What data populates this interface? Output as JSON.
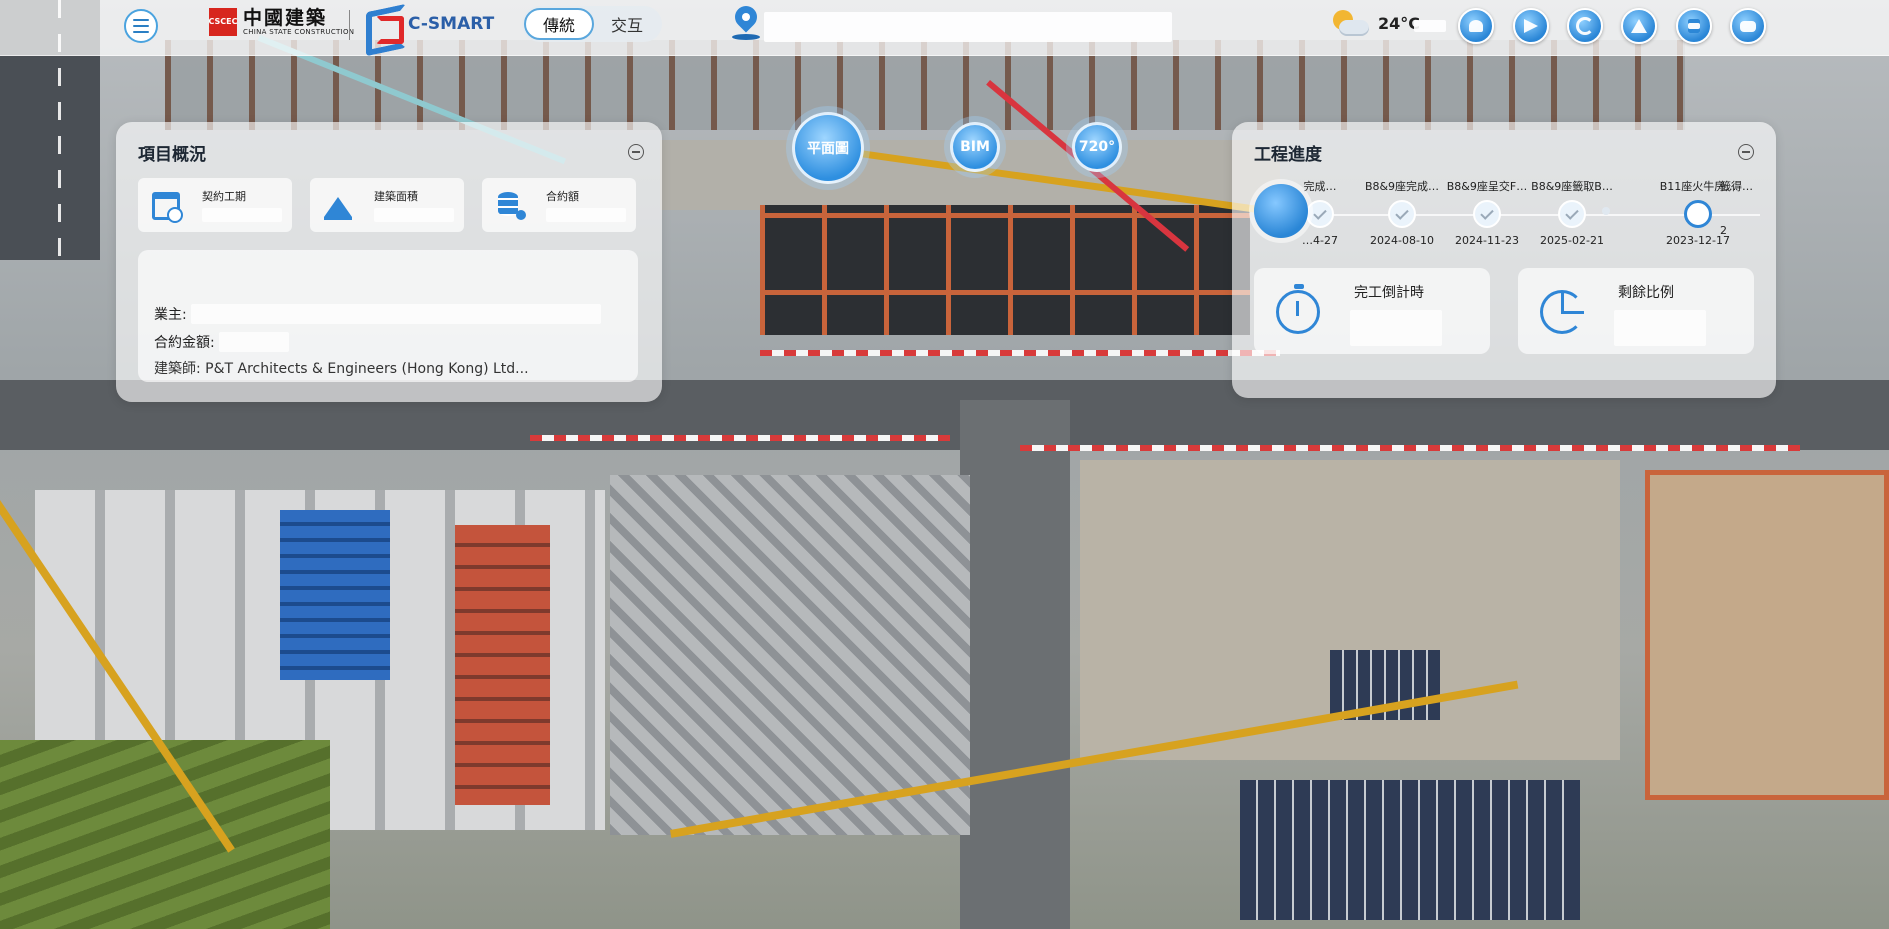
{
  "header": {
    "logo_mark_text": "CSCEC",
    "company_cn": "中國建築",
    "company_en": "CHINA STATE CONSTRUCTION",
    "product_name": "C-SMART",
    "mode_tabs": [
      {
        "label": "傳統",
        "active": true
      },
      {
        "label": "交互",
        "active": false
      }
    ],
    "search_value": "",
    "weather_icon": "partly-cloudy-icon",
    "temperature": "24°C",
    "tools": [
      {
        "name": "user-icon"
      },
      {
        "name": "send-icon"
      },
      {
        "name": "sync-icon"
      },
      {
        "name": "warning-icon"
      },
      {
        "name": "list-icon"
      },
      {
        "name": "robot-icon"
      }
    ]
  },
  "views": {
    "plan": "平面圖",
    "bim": "BIM",
    "pano": "720°"
  },
  "overview": {
    "title": "項目概況",
    "stats": [
      {
        "label": "契約工期",
        "icon": "calendar-icon"
      },
      {
        "label": "建築面積",
        "icon": "area-chart-icon"
      },
      {
        "label": "合約額",
        "icon": "database-icon"
      }
    ],
    "owner_label": "業主:",
    "contract_amount_label": "合約金額:",
    "architect_text": "建築師: P&T Architects & Engineers (Hong Kong) Ltd..."
  },
  "progress": {
    "title": "工程進度",
    "milestones": [
      {
        "name": "完成…",
        "date": "…4-27",
        "state": "done"
      },
      {
        "name": "B8&9座完成…",
        "date": "2024-08-10",
        "state": "done"
      },
      {
        "name": "B8&9座呈交F…",
        "date": "2024-11-23",
        "state": "done"
      },
      {
        "name": "B8&9座籤取B…",
        "date": "2025-02-21",
        "state": "done"
      },
      {
        "name": "",
        "date": "",
        "state": "pending"
      },
      {
        "name": "B11座火牛房…",
        "date": "2023-12-17",
        "state": "current"
      },
      {
        "name": "籤得…",
        "date": "2",
        "state": "pending"
      }
    ],
    "countdown_label": "完工倒計時",
    "remaining_label": "剩餘比例"
  },
  "colors": {
    "accent": "#2f86d6",
    "brand_red": "#d7261e"
  }
}
